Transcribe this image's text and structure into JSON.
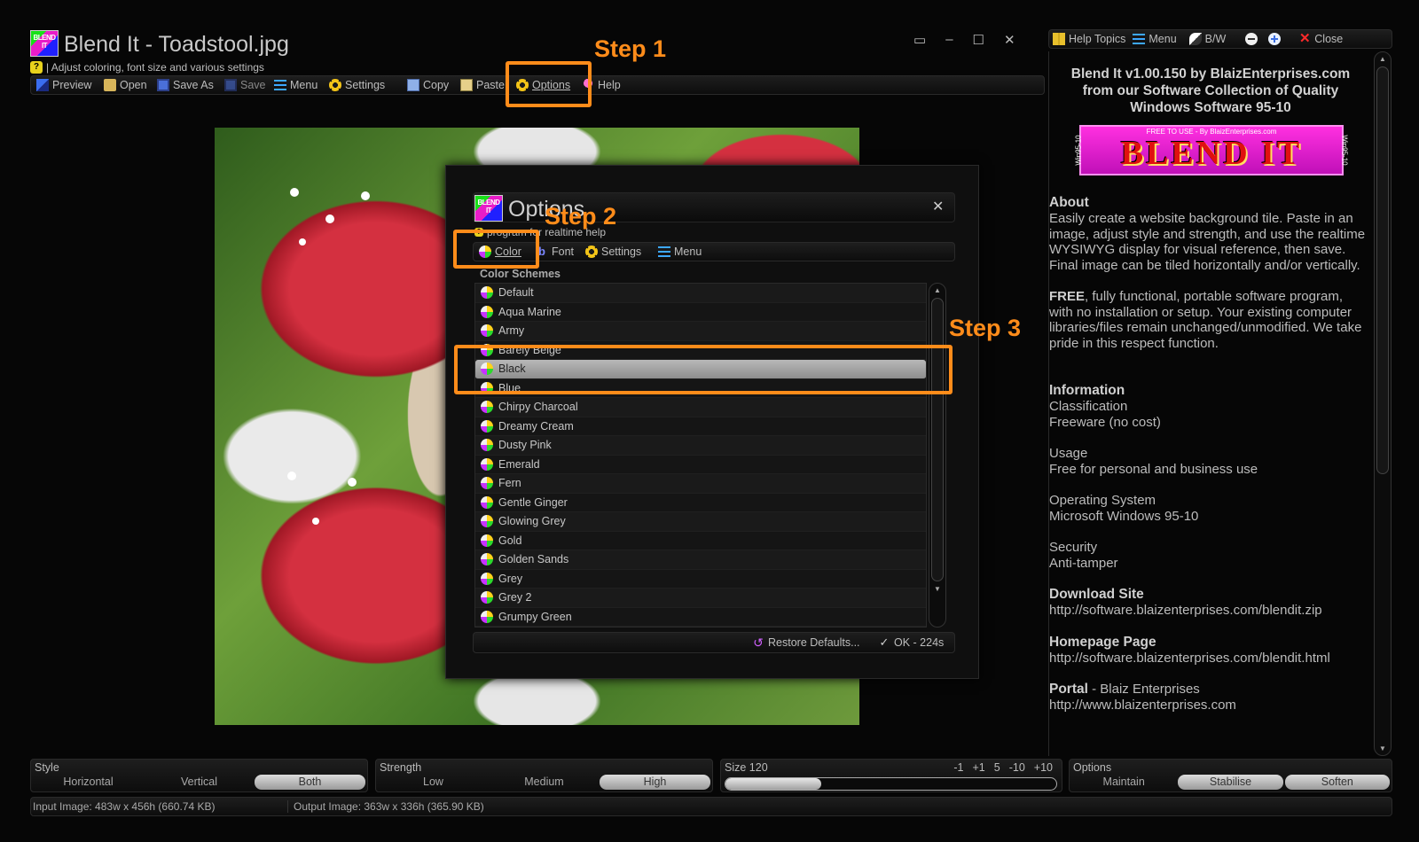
{
  "window": {
    "title": "Blend It - Toadstool.jpg",
    "logo_text": "BLEND IT",
    "hint": "| Adjust coloring, font size and various settings",
    "controls": {
      "restore": "▭",
      "minimize": "–",
      "maximize": "☐",
      "close": "✕"
    }
  },
  "toolbar": [
    {
      "label": "Preview",
      "icon": "preview-icon"
    },
    {
      "label": "Open",
      "icon": "folder-icon"
    },
    {
      "label": "Save As",
      "icon": "save-as-icon"
    },
    {
      "label": "Save",
      "icon": "save-icon"
    },
    {
      "label": "Menu",
      "icon": "menu-icon"
    },
    {
      "label": "Settings",
      "icon": "gear-icon"
    },
    {
      "label": "Copy",
      "icon": "copy-icon"
    },
    {
      "label": "Paste",
      "icon": "paste-icon"
    },
    {
      "label": "Options",
      "icon": "gear-icon"
    },
    {
      "label": "Help",
      "icon": "help-icon"
    }
  ],
  "annotations": {
    "step1": "Step 1",
    "step2": "Step 2",
    "step3": "Step 3"
  },
  "dialog": {
    "title": "Options",
    "close": "✕",
    "hint": "program for realtime help",
    "tabs": {
      "color": "Color",
      "font": "Font",
      "settings": "Settings",
      "menu": "Menu"
    },
    "section_title": "Color Schemes",
    "schemes": [
      "Default",
      "Aqua Marine",
      "Army",
      "Barely Beige",
      "Black",
      "Blue",
      "Chirpy Charcoal",
      "Dreamy Cream",
      "Dusty Pink",
      "Emerald",
      "Fern",
      "Gentle Ginger",
      "Glowing Grey",
      "Gold",
      "Golden Sands",
      "Grey",
      "Grey 2",
      "Grumpy Green"
    ],
    "selected_scheme": "Black",
    "restore_label": "Restore Defaults...",
    "ok_label": "OK - 224s"
  },
  "help_panel": {
    "toolbar": {
      "help_topics": "Help Topics",
      "menu": "Menu",
      "bw": "B/W",
      "close": "Close"
    },
    "header_line1": "Blend It v1.00.150 by BlaizEnterprises.com",
    "header_line2": "from our Software Collection of Quality",
    "header_line3": "Windows Software 95-10",
    "banner_top": "FREE TO USE - By BlaizEnterprises.com",
    "banner_text": "BLEND IT",
    "banner_left": "Win95-10",
    "banner_right": "Win95-10",
    "about_title": "About",
    "about_text": "Easily create a website background tile.  Paste in an image, adjust style and strength, and use the realtime WYSIWYG display for visual reference, then save.  Final image can be tiled horizontally and/or vertically.",
    "free_bold": "FREE",
    "free_text": ", fully functional, portable software program, with no installation or setup. Your existing computer libraries/files remain unchanged/unmodified.  We take pride in this respect function.",
    "info_title": "Information",
    "classification_label": "Classification",
    "classification_value": "Freeware (no cost)",
    "usage_label": "Usage",
    "usage_value": "Free for personal and business use",
    "os_label": "Operating System",
    "os_value": "Microsoft Windows 95-10",
    "security_label": "Security",
    "security_value": "Anti-tamper",
    "download_title": "Download Site",
    "download_url": "http://software.blaizenterprises.com/blendit.zip",
    "homepage_title": "Homepage Page",
    "homepage_url": "http://software.blaizenterprises.com/blendit.html",
    "portal_title": "Portal",
    "portal_text": " - Blaiz Enterprises",
    "portal_url": "http://www.blaizenterprises.com"
  },
  "bottom": {
    "style": {
      "label": "Style",
      "options": [
        "Horizontal",
        "Vertical",
        "Both"
      ],
      "selected": "Both"
    },
    "strength": {
      "label": "Strength",
      "options": [
        "Low",
        "Medium",
        "High"
      ],
      "selected": "High"
    },
    "size": {
      "label": "Size 120",
      "buttons": [
        "-1",
        "+1",
        "5",
        "-10",
        "+10"
      ],
      "value": 120,
      "fill_fraction": 0.29
    },
    "options": {
      "label": "Options",
      "options": [
        "Maintain",
        "Stabilise",
        "Soften"
      ],
      "selected": [
        "Stabilise",
        "Soften"
      ]
    }
  },
  "status": {
    "input": "Input Image: 483w x 456h (660.74 KB)",
    "output": "Output Image: 363w x 336h (365.90 KB)"
  }
}
